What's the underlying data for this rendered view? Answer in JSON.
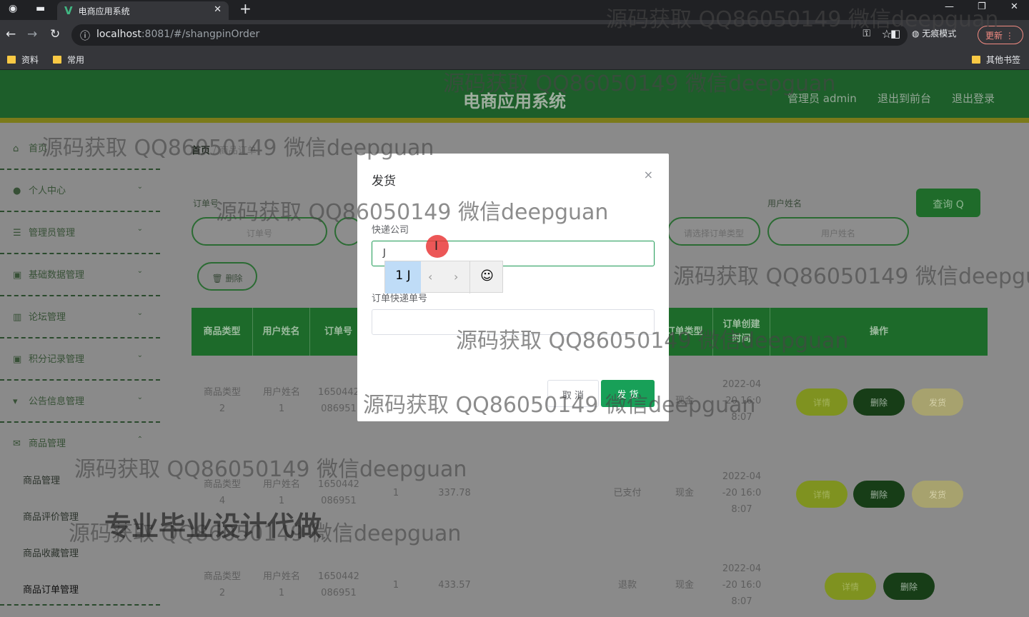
{
  "browser": {
    "tab_title": "电商应用系统",
    "tab_logo": "V",
    "url_host": "localhost",
    "url_rest": ":8081/#/shangpinOrder",
    "incognito_label": "无痕模式",
    "update_label": "更新",
    "bookmarks": [
      "资料",
      "常用"
    ],
    "other_bookmarks": "其他书签"
  },
  "header": {
    "title": "电商应用系统",
    "admin": "管理员 admin",
    "back_front": "退出到前台",
    "logout": "退出登录"
  },
  "sidebar": {
    "items": [
      {
        "label": "首页",
        "icon": "home-icon"
      },
      {
        "label": "个人中心",
        "icon": "user-icon"
      },
      {
        "label": "管理员管理",
        "icon": "list-icon"
      },
      {
        "label": "基础数据管理",
        "icon": "box-icon"
      },
      {
        "label": "论坛管理",
        "icon": "bar-chart-icon"
      },
      {
        "label": "积分记录管理",
        "icon": "box-icon"
      },
      {
        "label": "公告信息管理",
        "icon": "pin-icon"
      },
      {
        "label": "商品管理",
        "icon": "mail-icon"
      }
    ],
    "sub_items": [
      "商品管理",
      "商品评价管理",
      "商品收藏管理",
      "商品订单管理"
    ]
  },
  "breadcrumb": {
    "home": "首页",
    "sep": "/",
    "current": "商品订单"
  },
  "filters": {
    "order_no_label": "订单号",
    "order_no_placeholder": "订单号",
    "status_placeholder": "请选择订单类型",
    "username_label": "用户姓名",
    "username_placeholder": "用户姓名",
    "query_label": "查询 Q",
    "delete_label": "删除"
  },
  "table": {
    "headers": [
      "商品类型",
      "用户姓名",
      "订单号",
      "订单类型",
      "订单创建时间",
      "操作"
    ],
    "rows": [
      {
        "type": "商品类型\n2",
        "user": "用户姓名\n1",
        "order": "1650442\n086951",
        "qty": "",
        "price": "",
        "status": "",
        "pay": "现金",
        "time": "2022-04\n-20 16:0\n8:07",
        "actions": [
          "详情",
          "删除",
          "发货"
        ]
      },
      {
        "type": "商品类型\n4",
        "user": "用户姓名\n1",
        "order": "1650442\n086951",
        "qty": "1",
        "price": "337.78",
        "status": "已支付",
        "pay": "现金",
        "time": "2022-04\n-20 16:0\n8:07",
        "actions": [
          "详情",
          "删除",
          "发货"
        ]
      },
      {
        "type": "商品类型\n2",
        "user": "用户姓名\n1",
        "order": "1650442\n086951",
        "qty": "1",
        "price": "433.57",
        "status": "退款",
        "pay": "现金",
        "time": "2022-04\n-20 16:0\n8:07",
        "actions": [
          "详情",
          "删除"
        ]
      }
    ]
  },
  "modal": {
    "title": "发货",
    "close": "×",
    "courier_label": "快递公司",
    "courier_value": "J",
    "tracking_label": "订单快递单号",
    "tracking_value": "",
    "cancel": "取 消",
    "confirm": "发 货"
  },
  "ime": {
    "candidate": "1 J",
    "prev": "‹",
    "next": "›",
    "emoji": "☺"
  },
  "watermarks": {
    "text": "源码获取 QQ86050149 微信deepguan",
    "text_cut": "源码获取 QQ86050149 微信deepgu",
    "big": "专业毕业设计代做"
  },
  "colors": {
    "header": "#1d5e2a",
    "accent": "#18a058",
    "overlay": "#8a8a8a"
  }
}
